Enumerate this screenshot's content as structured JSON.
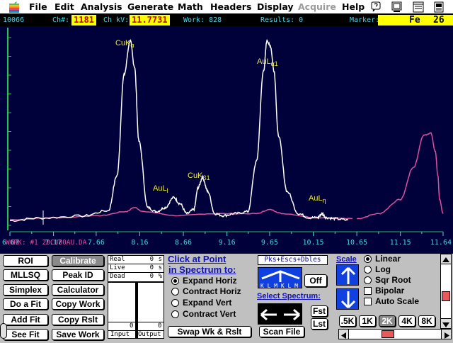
{
  "menubar": {
    "items": [
      {
        "label": "File",
        "enabled": true
      },
      {
        "label": "Edit",
        "enabled": true
      },
      {
        "label": "Analysis",
        "enabled": true
      },
      {
        "label": "Generate",
        "enabled": true
      },
      {
        "label": "Math",
        "enabled": true
      },
      {
        "label": "Headers",
        "enabled": true
      },
      {
        "label": "Display",
        "enabled": true
      },
      {
        "label": "Acquire",
        "enabled": false
      },
      {
        "label": "Help",
        "enabled": true
      }
    ],
    "icons": [
      "apple-icon",
      "balloon-help-icon",
      "monitor-icon",
      "application-icon"
    ]
  },
  "status": {
    "counts": "10066",
    "ch_label": "Ch#:",
    "ch_value": "1181",
    "kv_label": "Ch kV:",
    "kv_value": "11.7731",
    "work_label": "Work: 828",
    "results": "Results: 0",
    "marker_label": "Marker:",
    "marker_element": "Fe",
    "marker_number": "26"
  },
  "spectrum": {
    "work_label": "WORK: #1   20CU80AU.DA",
    "x_ticks": [
      "6.67",
      "7.17",
      "7.66",
      "8.16",
      "8.66",
      "9.16",
      "9.65",
      "10.15",
      "10.65",
      "11.15",
      "11.64"
    ],
    "peak_labels": [
      {
        "base": "CuK",
        "sub": "α"
      },
      {
        "base": "AuL",
        "sub": "l"
      },
      {
        "base": "CuK",
        "sub": "β1"
      },
      {
        "base": "AuL",
        "sub": "α1"
      },
      {
        "base": "AuL",
        "sub": "η"
      }
    ],
    "colors": {
      "background": "#00003a",
      "axis": "#22c455",
      "work_trace": "#ffffff",
      "overlay_trace": "#e04f9d",
      "labels": "#e8e840",
      "ticks": "#4fd2e6"
    }
  },
  "chart_data": {
    "type": "line",
    "x_unit_ticks": [
      6.67,
      7.17,
      7.66,
      8.16,
      8.66,
      9.16,
      9.65,
      10.15,
      10.65,
      11.15,
      11.64
    ],
    "xlim": [
      6.67,
      11.64
    ],
    "series": [
      {
        "x": [
          6.67,
          7.0,
          7.5,
          7.8,
          7.9,
          7.98,
          8.05,
          8.1,
          8.15,
          8.25,
          8.35,
          8.45,
          8.55,
          8.62,
          8.7,
          8.78,
          8.83,
          8.88,
          8.94,
          9.02,
          9.12,
          9.25,
          9.4,
          9.5,
          9.58,
          9.62,
          9.66,
          9.7,
          9.75,
          9.85,
          9.98,
          10.1,
          10.2,
          10.25,
          10.3,
          10.4,
          10.55
        ],
        "y": [
          5.5,
          6.8,
          7.8,
          10.5,
          28,
          78,
          95,
          82,
          45,
          12,
          10,
          12,
          17,
          14,
          9,
          11,
          22,
          27,
          20,
          9,
          8,
          9,
          10,
          35,
          80,
          95,
          92,
          80,
          48,
          20,
          9,
          7,
          7,
          9,
          7,
          6.5,
          5.8
        ]
      },
      {
        "x": [
          10.65,
          10.9,
          11.15,
          11.3,
          11.42,
          11.5,
          11.55,
          11.58,
          11.6,
          11.64
        ],
        "y": [
          6.5,
          9,
          16,
          32,
          48,
          49,
          40,
          28,
          16,
          9
        ]
      }
    ]
  },
  "panel": {
    "col1": [
      {
        "label": "ROI",
        "highlight": false
      },
      {
        "label": "MLLSQ",
        "highlight": false
      },
      {
        "label": "Simplex",
        "highlight": false
      },
      {
        "label": "Do a Fit",
        "highlight": false
      },
      {
        "label": "Add Fit",
        "highlight": false
      },
      {
        "label": "See Fit",
        "highlight": false
      }
    ],
    "col2": [
      {
        "label": "Calibrate",
        "highlight": true
      },
      {
        "label": "Peak ID",
        "highlight": false
      },
      {
        "label": "Calculator",
        "highlight": false
      },
      {
        "label": "Copy Work",
        "highlight": false
      },
      {
        "label": "Copy Rslt",
        "highlight": false
      },
      {
        "label": "Save Work",
        "highlight": false
      }
    ],
    "timers": [
      {
        "name": "Real",
        "value": "0",
        "unit": "s"
      },
      {
        "name": "Live",
        "value": "0",
        "unit": "s"
      },
      {
        "name": "Dead",
        "value": "0",
        "unit": "%"
      }
    ],
    "io": {
      "input_value": "0",
      "output_value": "0",
      "input_label": "Input",
      "output_label": "Output"
    },
    "click_heading_1": "Click at Point",
    "click_heading_2": "in Spectrum to:",
    "click_options": [
      {
        "label": "Expand Horiz",
        "selected": true
      },
      {
        "label": "Contract Horiz",
        "selected": false
      },
      {
        "label": "Expand Vert",
        "selected": false
      },
      {
        "label": "Contract Vert",
        "selected": false
      }
    ],
    "swap_button": "Swap Wk & Rslt",
    "pks_field": "Pks+Escs+Dbles",
    "off_button": "Off",
    "klm_text": "K L M K L M",
    "select_spectrum": "Select Spectrum:",
    "fst_button": "Fst",
    "lst_button": "Lst",
    "scan_button": "Scan File",
    "scale_label": "Scale",
    "scale_options": [
      {
        "label": "Linear",
        "type": "radio",
        "selected": true
      },
      {
        "label": "Log",
        "type": "radio",
        "selected": false
      },
      {
        "label": "Sqr Root",
        "type": "radio",
        "selected": false
      },
      {
        "label": "Bipolar",
        "type": "check",
        "selected": false
      },
      {
        "label": "Auto Scale",
        "type": "check",
        "selected": false
      }
    ],
    "scale_buttons": [
      {
        "label": ".5K",
        "selected": false
      },
      {
        "label": "1K",
        "selected": false
      },
      {
        "label": "2K",
        "selected": true
      },
      {
        "label": "4K",
        "selected": false
      },
      {
        "label": "8K",
        "selected": false
      }
    ]
  }
}
